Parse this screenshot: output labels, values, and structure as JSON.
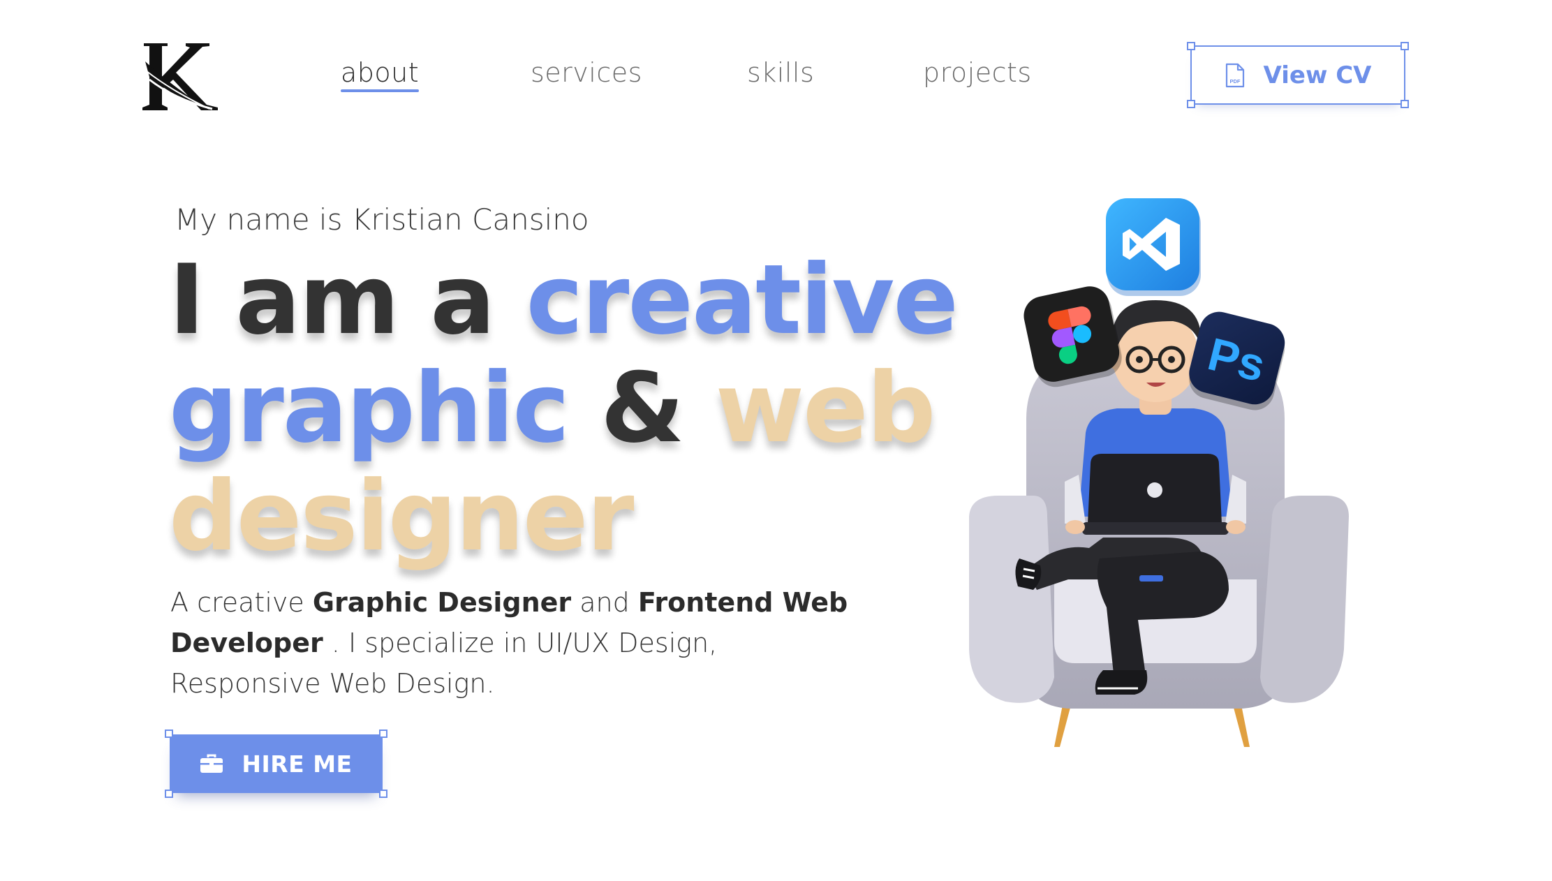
{
  "header": {
    "logo_icon": "k-feather-logo",
    "nav": [
      {
        "label": "about",
        "active": true
      },
      {
        "label": "services",
        "active": false
      },
      {
        "label": "skills",
        "active": false
      },
      {
        "label": "projects",
        "active": false
      }
    ],
    "cv_button": {
      "label": "View CV",
      "icon": "pdf-file-icon"
    }
  },
  "hero": {
    "intro": "My name is Kristian Cansino",
    "headline": {
      "w1": "I am a",
      "w2": "creative",
      "w3": "graphic",
      "w4": "&",
      "w5": "web",
      "w6": "designer"
    },
    "description": {
      "t1": "A creative ",
      "b1": "Graphic Designer",
      "t2": " and ",
      "b2": "Frontend Web Developer",
      "t3": " . I specialize in UI/UX Design, Responsive Web Design."
    },
    "hire_button": {
      "label": "HIRE ME",
      "icon": "briefcase-icon"
    }
  },
  "illustration": {
    "icons": [
      "vscode-icon",
      "figma-icon",
      "photoshop-icon"
    ],
    "photoshop_text": "Ps"
  },
  "colors": {
    "accent_blue": "#6d8fe9",
    "accent_tan": "#edd2a6",
    "text_dark": "#333333"
  }
}
